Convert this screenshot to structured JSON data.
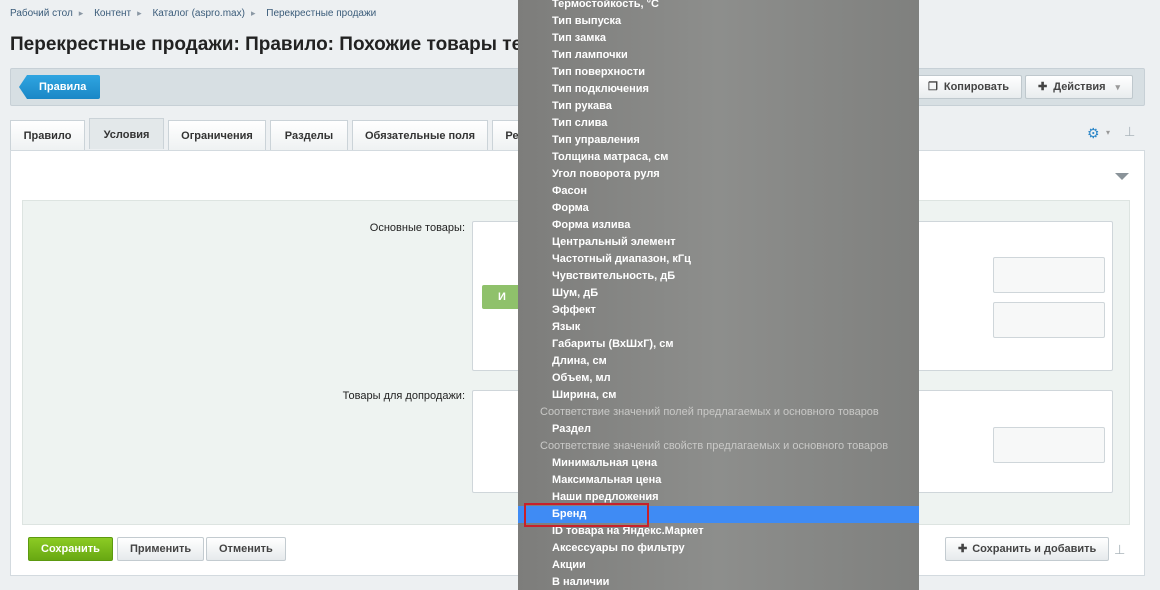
{
  "breadcrumb": [
    "Рабочий стол",
    "Контент",
    "Каталог (aspro.max)",
    "Перекрестные продажи"
  ],
  "page_title": "Перекрестные продажи: Правило: Похожие товары те",
  "toolbar": {
    "back_label": "Правила",
    "copy_label": "Копировать",
    "actions_label": "Действия"
  },
  "tabs": [
    "Правило",
    "Условия",
    "Ограничения",
    "Разделы",
    "Обязательные поля",
    "Ре"
  ],
  "form": {
    "main_goods_label": "Основные товары:",
    "extra_goods_label": "Товары для допродажи:",
    "and_label": "И"
  },
  "bottom": {
    "save": "Сохранить",
    "apply": "Применить",
    "cancel": "Отменить",
    "save_add": "Сохранить и добавить"
  },
  "dropdown": {
    "items_top": [
      "Термостойкость, °С",
      "Тип выпуска",
      "Тип замка",
      "Тип лампочки",
      "Тип поверхности",
      "Тип подключения",
      "Тип рукава",
      "Тип слива",
      "Тип управления",
      "Толщина матраса, см",
      "Угол поворота руля",
      "Фасон",
      "Форма",
      "Форма излива",
      "Центральный элемент",
      "Частотный диапазон, кГц",
      "Чувствительность, дБ",
      "Шум, дБ",
      "Эффект",
      "Язык",
      "Габариты (ВхШхГ), см",
      "Длина, см",
      "Объем, мл",
      "Ширина, см"
    ],
    "group1": "Соответствие значений полей предлагаемых и основного товаров",
    "group1_items": [
      "Раздел"
    ],
    "group2": "Соответствие значений свойств предлагаемых и основного товаров",
    "group2_items": [
      "Минимальная цена",
      "Максимальная цена",
      "Наши предложения",
      "Бренд",
      "ID товара на Яндекс.Маркет",
      "Аксессуары по фильтру",
      "Акции",
      "В наличии"
    ],
    "selected": "Бренд"
  },
  "colors": {
    "accent": "#1a87c6",
    "save_green": "#68a812",
    "selection_blue": "#3f8bf4",
    "highlight_red": "#c8202a"
  }
}
